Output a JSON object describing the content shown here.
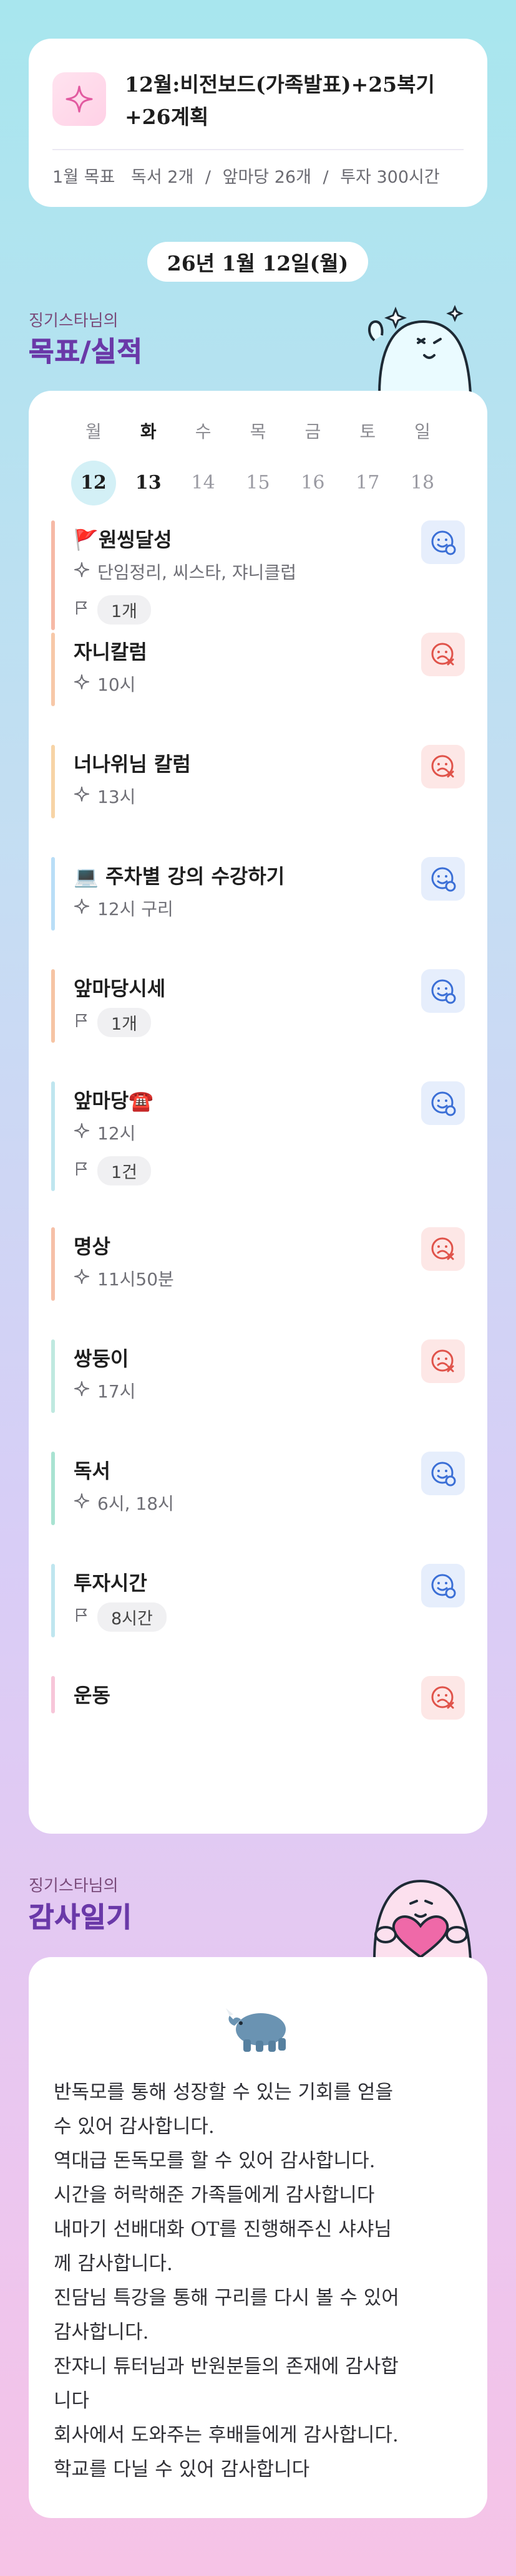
{
  "monthly": {
    "icon": "sparkle-icon",
    "title": "12월:비전보드(가족발표)+25복기+26계획",
    "sub_label": "1월 목표",
    "sub_items": [
      "독서 2개",
      "앞마당 26개",
      "투자 300시간"
    ],
    "separator": "/"
  },
  "date_pill": "26년 1월 12일(월)",
  "goals_section": {
    "owner": "징기스타님의",
    "title": "목표/실적"
  },
  "week": {
    "days": [
      "월",
      "화",
      "수",
      "목",
      "금",
      "토",
      "일"
    ],
    "dates": [
      "12",
      "13",
      "14",
      "15",
      "16",
      "17",
      "18"
    ]
  },
  "items": [
    {
      "title": "🚩원씽달성",
      "detail": "단임정리, 씨스타, 쟈니클럽",
      "tag": "1개",
      "status": "done",
      "bar_color": "#f6b9a6"
    },
    {
      "title": "자니칼럼",
      "detail": "10시",
      "tag": "",
      "status": "fail",
      "bar_color": "#f7c8a8"
    },
    {
      "title": "너나위님 칼럼",
      "detail": "13시",
      "tag": "",
      "status": "fail",
      "bar_color": "#f7d4a6"
    },
    {
      "title": "💻 주차별 강의 수강하기",
      "detail": "12시 구리",
      "tag": "",
      "status": "done",
      "bar_color": "#b9def7"
    },
    {
      "title": "앞마당시세",
      "detail": "",
      "tag": "1개",
      "status": "done",
      "bar_color": "#f6c4a4"
    },
    {
      "title": "앞마당☎️",
      "detail": "12시",
      "tag": "1건",
      "status": "done",
      "bar_color": "#bfe6ef"
    },
    {
      "title": "명상",
      "detail": "11시50분",
      "tag": "",
      "status": "fail",
      "bar_color": "#f6c0a8"
    },
    {
      "title": "쌍둥이",
      "detail": "17시",
      "tag": "",
      "status": "fail",
      "bar_color": "#bfe9e0"
    },
    {
      "title": "독서",
      "detail": "6시, 18시",
      "tag": "",
      "status": "done",
      "bar_color": "#a9e3d2"
    },
    {
      "title": "투자시간",
      "detail": "",
      "tag": "8시간",
      "status": "done",
      "bar_color": "#bfe6ef"
    },
    {
      "title": "운동",
      "detail": "",
      "tag": "",
      "status": "fail",
      "bar_color": "#f7c6d9"
    }
  ],
  "gratitude_section": {
    "owner": "징기스타님의",
    "title": "감사일기"
  },
  "gratitude_lines": [
    "반독모를 통해 성장할 수 있는 기회를 얻을",
    "수 있어 감사합니다.",
    "역대급 돈독모를 할 수 있어 감사합니다.",
    "시간을 허락해준 가족들에게 감사합니다",
    "내마기 선배대화 OT를 진행해주신 샤샤님",
    "께 감사합니다.",
    "진담님 특강을 통해 구리를 다시 볼 수 있어",
    "감사합니다.",
    "잔쟈니 튜터님과 반원분들의 존재에 감사합",
    "니다",
    "회사에서 도와주는 후배들에게 감사합니다.",
    "학교를 다닐 수 있어 감사합니다"
  ],
  "colors": {
    "accent_purple": "#6a39a8",
    "done": "#3b6fd6",
    "fail": "#e0534a",
    "selected_date_bg": "#d3f0f6"
  }
}
